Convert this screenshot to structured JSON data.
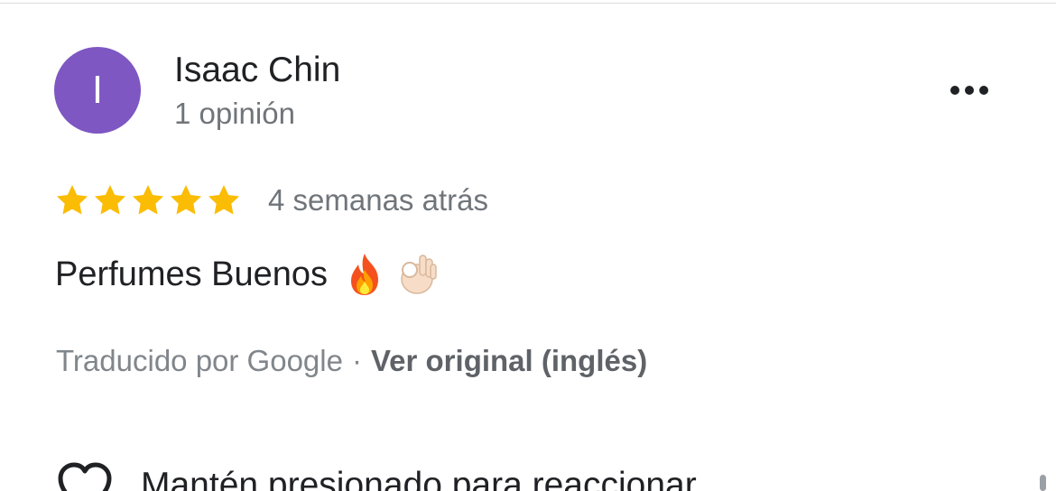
{
  "reviewer": {
    "avatar_letter": "I",
    "avatar_color": "#7e57c2",
    "name": "Isaac Chin",
    "review_count": "1 opinión"
  },
  "menu": {
    "icon": "more-horizontal-icon"
  },
  "review": {
    "rating": 5,
    "rating_max": 5,
    "star_color": "#fbbc04",
    "time": "4 semanas atrás",
    "text": "Perfumes Buenos",
    "emojis": [
      "fire-emoji",
      "ok-hand-emoji"
    ]
  },
  "translation": {
    "label": "Traducido por Google",
    "separator": "·",
    "view_original": "Ver original (inglés)"
  },
  "reaction": {
    "icon": "heart-icon",
    "label": "Mantén presionado para reaccionar"
  }
}
